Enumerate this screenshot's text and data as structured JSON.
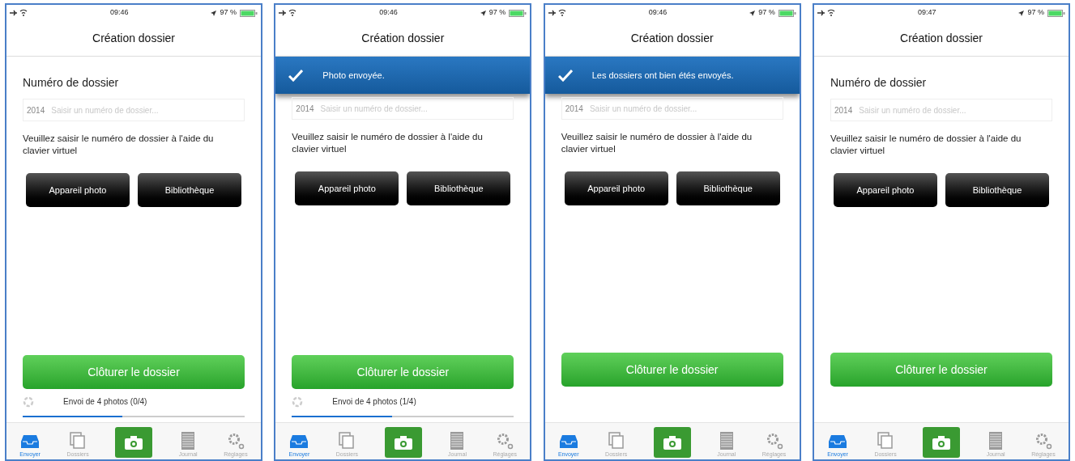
{
  "screens": [
    {
      "status": {
        "time": "09:46",
        "battery": "97 %"
      },
      "title": "Création dossier",
      "label": "Numéro de dossier",
      "field": {
        "prefix": "2014",
        "placeholder": "Saisir un numéro de dossier..."
      },
      "hint": "Veuillez saisir le numéro de dossier à l'aide du clavier virtuel",
      "buttons": [
        "Appareil photo",
        "Bibliothèque"
      ],
      "primary": "Clôturer le dossier",
      "upload": {
        "text": "Envoi de 4 photos (0/4)",
        "level": 0.45
      },
      "tabs": [
        {
          "kind": "inbox",
          "label": "Envoyer",
          "selected": true
        },
        {
          "kind": "copies",
          "label": "Dossiers",
          "selected": false
        },
        {
          "kind": "camera",
          "selected": false
        },
        {
          "kind": "list",
          "label": "Journal",
          "selected": false
        },
        {
          "kind": "gears",
          "label": "Réglages",
          "selected": false
        }
      ]
    },
    {
      "status": {
        "time": "09:46",
        "battery": "97 %"
      },
      "title": "Création dossier",
      "banner": "Photo envoyée.",
      "field": {
        "prefix": "2014",
        "placeholder": "Saisir un numéro de dossier..."
      },
      "hint": "Veuillez saisir le numéro de dossier à l'aide du clavier virtuel",
      "buttons": [
        "Appareil photo",
        "Bibliothèque"
      ],
      "primary": "Clôturer le dossier",
      "upload": {
        "text": "Envoi de 4 photos (1/4)",
        "level": 0.45
      },
      "tabs": [
        {
          "kind": "inbox",
          "label": "Envoyer",
          "selected": true
        },
        {
          "kind": "copies",
          "label": "Dossiers",
          "selected": false
        },
        {
          "kind": "camera",
          "selected": false
        },
        {
          "kind": "list",
          "label": "Journal",
          "selected": false
        },
        {
          "kind": "gears",
          "label": "Réglages",
          "selected": false
        }
      ]
    },
    {
      "status": {
        "time": "09:46",
        "battery": "97 %"
      },
      "title": "Création dossier",
      "banner": "Les dossiers ont bien étés envoyés.",
      "field": {
        "prefix": "2014",
        "placeholder": "Saisir un numéro de dossier..."
      },
      "hint": "Veuillez saisir le numéro de dossier à l'aide du clavier virtuel",
      "buttons": [
        "Appareil photo",
        "Bibliothèque"
      ],
      "primary": "Clôturer le dossier",
      "tabs": [
        {
          "kind": "inbox",
          "label": "Envoyer",
          "selected": true
        },
        {
          "kind": "copies",
          "label": "Dossiers",
          "selected": false
        },
        {
          "kind": "camera",
          "selected": false
        },
        {
          "kind": "list",
          "label": "Journal",
          "selected": false
        },
        {
          "kind": "gears",
          "label": "Réglages",
          "selected": false
        }
      ]
    },
    {
      "status": {
        "time": "09:47",
        "battery": "97 %"
      },
      "title": "Création dossier",
      "label": "Numéro de dossier",
      "field": {
        "prefix": "2014",
        "placeholder": "Saisir un numéro de dossier..."
      },
      "hint": "Veuillez saisir le numéro de dossier à l'aide du clavier virtuel",
      "buttons": [
        "Appareil photo",
        "Bibliothèque"
      ],
      "primary": "Clôturer le dossier",
      "tabs": [
        {
          "kind": "inbox",
          "label": "Envoyer",
          "selected": true
        },
        {
          "kind": "copies",
          "label": "Dossiers",
          "selected": false
        },
        {
          "kind": "camera",
          "selected": false
        },
        {
          "kind": "list",
          "label": "Journal",
          "selected": false
        },
        {
          "kind": "gears",
          "label": "Réglages",
          "selected": false
        }
      ]
    }
  ]
}
